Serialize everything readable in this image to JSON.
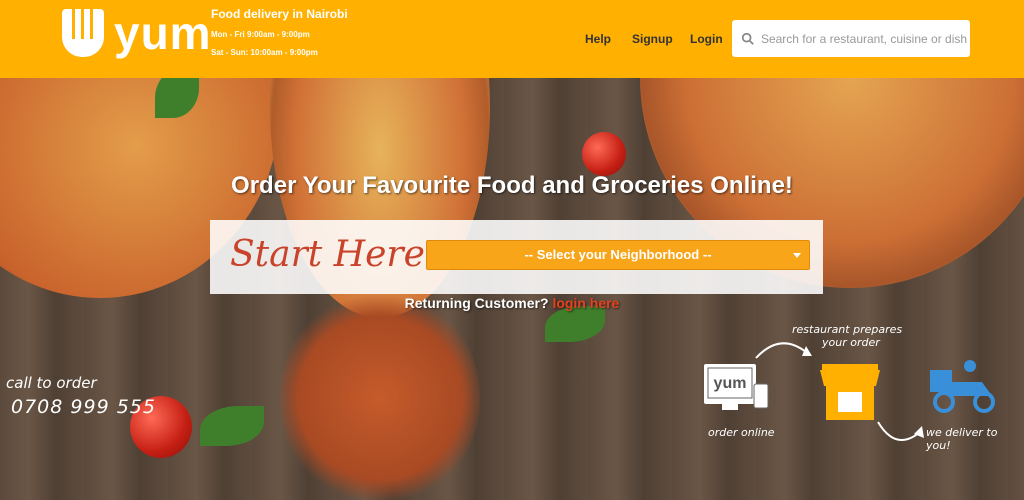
{
  "header": {
    "logo_text": "yum",
    "tagline": {
      "title": "Food delivery in Nairobi",
      "hours_weekday": "Mon - Fri 9:00am - 9:00pm",
      "hours_weekend": "Sat - Sun: 10:00am - 9:00pm"
    },
    "nav": {
      "help": "Help",
      "signup": "Signup",
      "login": "Login"
    },
    "search": {
      "placeholder": "Search for a restaurant, cuisine or dish"
    }
  },
  "hero": {
    "headline": "Order Your Favourite Food and Groceries Online!",
    "start_label": "Start Here",
    "select_value": "-- Select your Neighborhood --",
    "returning_text": "Returning Customer?",
    "login_link": "login here",
    "call": {
      "label": "call to order",
      "phone": "0708 999 555"
    },
    "steps": {
      "order": "order online",
      "prepare_line1": "restaurant prepares",
      "prepare_line2": "your order",
      "deliver": "we deliver to you!",
      "monitor_logo": "yum"
    }
  },
  "colors": {
    "brand": "#ffb000",
    "accent_orange": "#f9a51a",
    "link_red": "#e4421e",
    "delivery_blue": "#3a8fd9"
  }
}
